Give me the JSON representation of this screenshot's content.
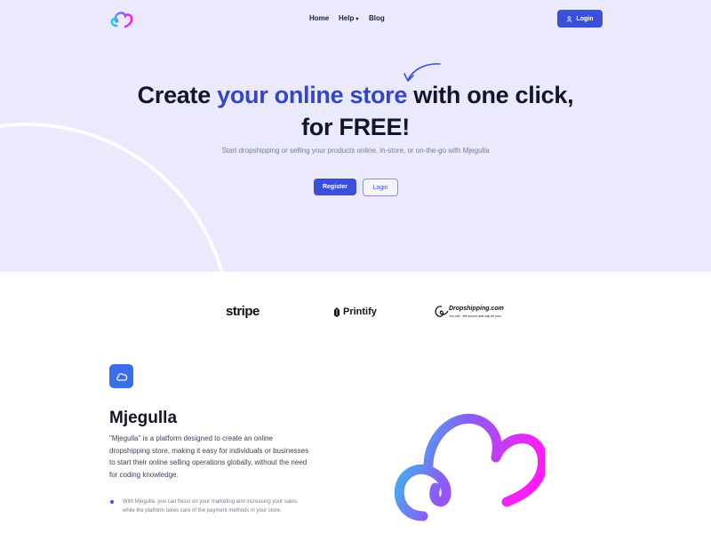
{
  "nav": {
    "home": "Home",
    "help": "Help",
    "blog": "Blog",
    "login": "Login"
  },
  "hero": {
    "headline_part1": "Create ",
    "headline_accent": "your online store",
    "headline_part2": " with one click, for FREE!",
    "subtitle": "Start dropshipping or selling your products online, in-store, or on-the-go with Mjegulla",
    "register": "Register",
    "login": "Login"
  },
  "partners": {
    "stripe": "stripe",
    "printify": "Printify",
    "dropshipping": "Dropshipping.com",
    "dropshipping_tagline": "You sell - We source and ship for you!"
  },
  "about": {
    "title": "Mjegulla",
    "description": "\"Mjegulla\" is a platform designed to create an online dropshipping store, making it easy for individuals or businesses to start their online selling operations globally, without the need for coding knowledge.",
    "bullet": "With Mjegulla, you can focus on your marketing and increasing your sales, while the platform takes care of the payment methods in your store."
  },
  "icons": {
    "logo": "cloud-logo-icon",
    "help_chevron": "chevron-down-icon",
    "login": "user-icon",
    "arrow": "curved-arrow-icon",
    "feature": "cloud-icon"
  },
  "colors": {
    "primary": "#3b4fd8",
    "accent_text": "#3346c8",
    "hero_bg": "#eaeafc",
    "gradient_start": "#22d3ee",
    "gradient_end": "#ff1cf7"
  }
}
